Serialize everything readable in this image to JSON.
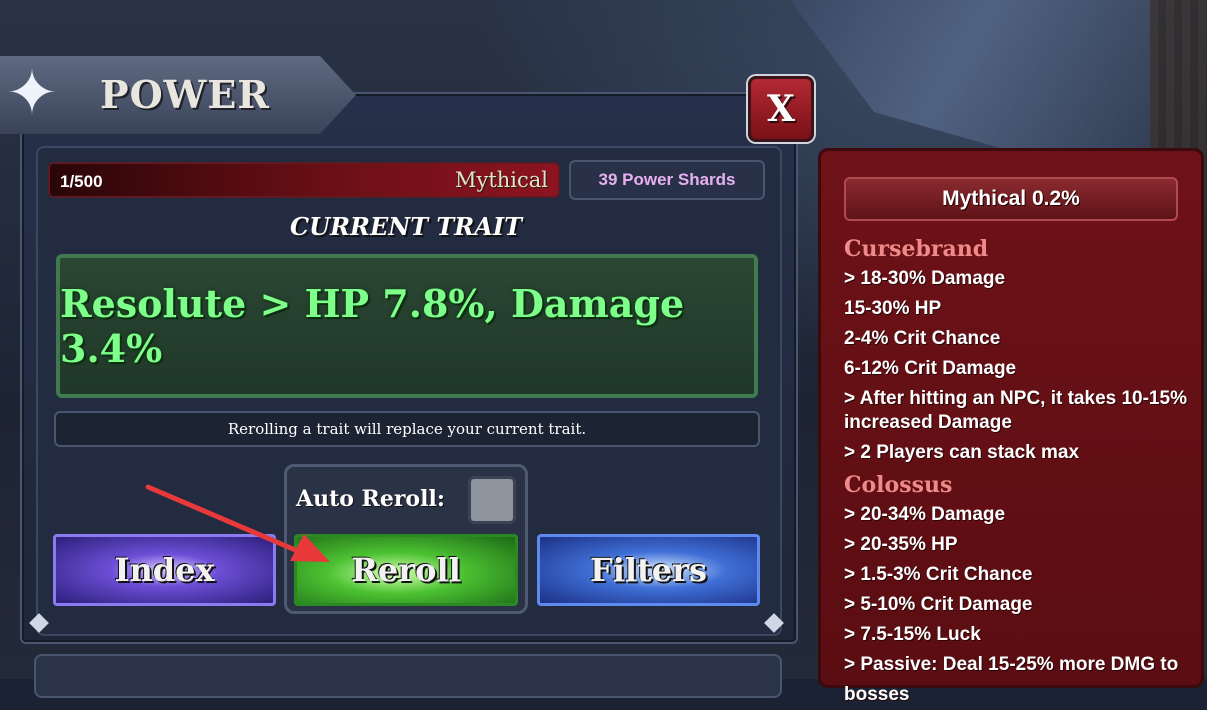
{
  "window": {
    "title": "POWER",
    "close_label": "X"
  },
  "status": {
    "count": "1/500",
    "rarity": "Mythical",
    "shards": "39 Power Shards"
  },
  "current_trait": {
    "heading": "CURRENT TRAIT",
    "value": "Resolute > HP 7.8%, Damage 3.4%"
  },
  "notice": "Rerolling a trait will replace your current trait.",
  "auto_reroll": {
    "label": "Auto Reroll:",
    "checked": false
  },
  "buttons": {
    "index": "Index",
    "reroll": "Reroll",
    "filters": "Filters"
  },
  "info_panel": {
    "header": "Mythical 0.2%",
    "traits": [
      {
        "name": "Cursebrand",
        "lines": [
          "> 18-30% Damage",
          "15-30% HP",
          "2-4% Crit Chance",
          "6-12% Crit Damage",
          "> After hitting an NPC, it takes 10-15% increased Damage",
          "> 2 Players can stack max"
        ]
      },
      {
        "name": "Colossus",
        "lines": [
          "> 20-34% Damage",
          "> 20-35% HP",
          "> 1.5-3% Crit Chance",
          "> 5-10% Crit Damage",
          "> 7.5-15% Luck",
          "> Passive: Deal 15-25% more DMG to bosses"
        ]
      }
    ]
  },
  "colors": {
    "accent_red": "#8c1420",
    "trait_green": "#7dff8a",
    "shards_pink": "#e6b0f0",
    "trait_name_pink": "#f08a8a"
  },
  "icons": [
    "star-icon",
    "close-icon",
    "arrow-annotation"
  ]
}
